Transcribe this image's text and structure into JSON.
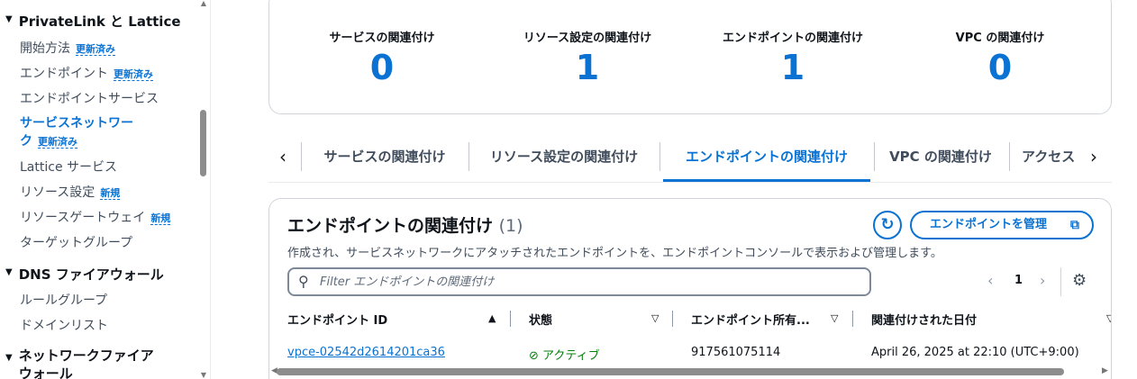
{
  "sidebar": {
    "sections": [
      {
        "title": "PrivateLink と Lattice"
      },
      {
        "title": "DNS ファイアウォール"
      },
      {
        "title_line1": "ネットワークファイア",
        "title_line2": "ウォール"
      }
    ],
    "items": [
      {
        "label": "開始方法",
        "badge": "更新済み"
      },
      {
        "label": "エンドポイント",
        "badge": "更新済み"
      },
      {
        "label": "エンドポイントサービス"
      },
      {
        "label_line1": "サービスネットワー",
        "label_line2": "ク",
        "badge": "更新済み"
      },
      {
        "label": "Lattice サービス"
      },
      {
        "label": "リソース設定",
        "badge": "新規"
      },
      {
        "label": "リソースゲートウェイ",
        "badge": "新規"
      },
      {
        "label": "ターゲットグループ"
      },
      {
        "label": "ルールグループ"
      },
      {
        "label": "ドメインリスト"
      }
    ]
  },
  "summary": [
    {
      "label": "サービスの関連付け",
      "value": "0"
    },
    {
      "label": "リソース設定の関連付け",
      "value": "1"
    },
    {
      "label": "エンドポイントの関連付け",
      "value": "1"
    },
    {
      "label": "VPC の関連付け",
      "value": "0"
    }
  ],
  "tabs": [
    {
      "label": "サービスの関連付け"
    },
    {
      "label": "リソース設定の関連付け"
    },
    {
      "label": "エンドポイントの関連付け",
      "active": true
    },
    {
      "label": "VPC の関連付け"
    },
    {
      "label": "アクセス"
    }
  ],
  "panel": {
    "title": "エンドポイントの関連付け",
    "count": "(1)",
    "description": "作成され、サービスネットワークにアタッチされたエンドポイントを、エンドポイントコンソールで表示および管理します。",
    "manage_label": "エンドポイントを管理",
    "filter_placeholder": "Filter エンドポイントの関連付け",
    "page": "1",
    "columns": [
      "エンドポイント ID",
      "状態",
      "エンドポイント所有...",
      "関連付けされた日付"
    ],
    "rows": [
      {
        "id": "vpce-02542d2614201ca36",
        "status": "アクティブ",
        "owner": "917561075114",
        "date": "April 26, 2025 at 22:10 (UTC+9:00)"
      }
    ]
  },
  "colors": {
    "accent": "#0972d3",
    "success": "#037f0c",
    "text": "#0f141a"
  },
  "icons": [
    "collapse-triangle-icon",
    "refresh-icon",
    "external-link-icon",
    "search-icon",
    "chevron-left-icon",
    "chevron-right-icon",
    "settings-gear-icon",
    "sort-ascending-icon",
    "sort-descending-icon",
    "status-success-icon"
  ]
}
